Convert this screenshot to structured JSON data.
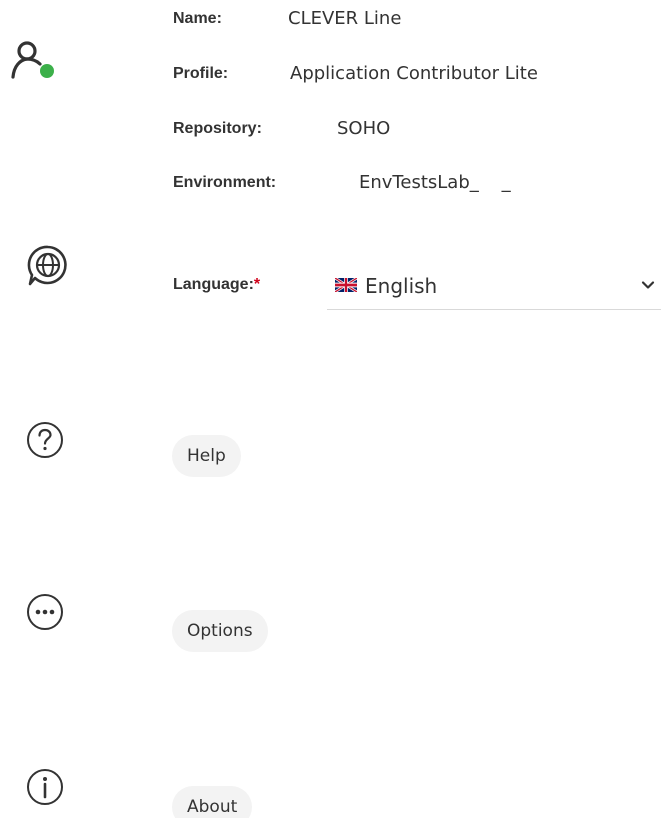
{
  "profile": {
    "icon": "user-online-icon",
    "status_color": "#3cb04a",
    "fields": {
      "name": {
        "label": "Name:",
        "value": "CLEVER Line"
      },
      "profile": {
        "label": "Profile:",
        "value": "Application Contributor Lite"
      },
      "repository": {
        "label": "Repository:",
        "value": "SOHO"
      },
      "environment": {
        "label": "Environment:",
        "value": "EnvTestsLab_    _"
      }
    }
  },
  "language": {
    "icon": "language-globe-icon",
    "label": "Language:",
    "required_marker": "*",
    "selected": "English",
    "flag_icon": "uk-flag-icon",
    "dropdown_icon": "chevron-down-icon"
  },
  "help": {
    "icon": "help-circle-icon",
    "button_label": "Help"
  },
  "options": {
    "icon": "more-options-icon",
    "button_label": "Options"
  },
  "about": {
    "icon": "info-circle-icon",
    "button_label": "About"
  },
  "colors": {
    "text": "#333333",
    "required": "#d0021b",
    "pill_bg": "#f3f3f3",
    "online": "#3cb04a"
  }
}
